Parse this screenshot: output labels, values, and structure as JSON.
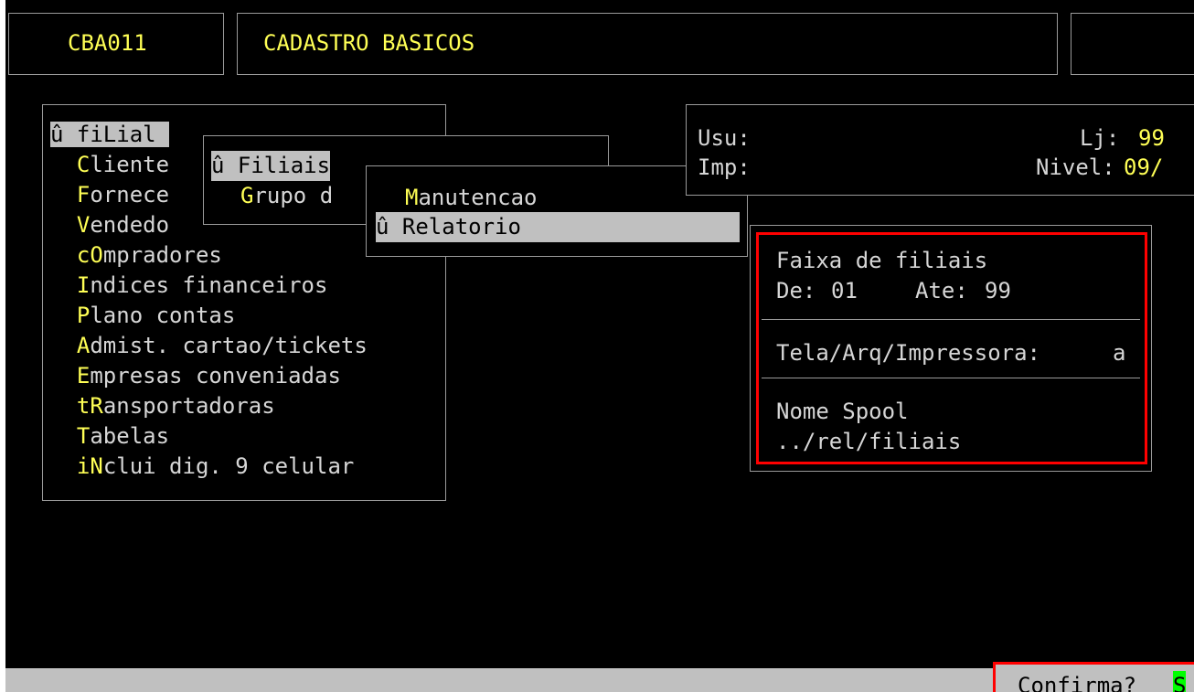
{
  "header": {
    "program_code": "CBA011",
    "title": "CADASTRO BASICOS"
  },
  "main_menu": {
    "items": [
      {
        "prefix": "û ",
        "hotkey": "",
        "rest": "fiLial",
        "selected": true
      },
      {
        "prefix": "  ",
        "hotkey": "C",
        "rest": "liente"
      },
      {
        "prefix": "  ",
        "hotkey": "F",
        "rest": "ornece"
      },
      {
        "prefix": "  ",
        "hotkey": "V",
        "rest": "endedo"
      },
      {
        "prefix": "  ",
        "hotkey": "cO",
        "rest": "mpradores"
      },
      {
        "prefix": "  ",
        "hotkey": "I",
        "rest": "ndices financeiros"
      },
      {
        "prefix": "  ",
        "hotkey": "P",
        "rest": "lano contas"
      },
      {
        "prefix": "  ",
        "hotkey": "A",
        "rest": "dmist. cartao/tickets"
      },
      {
        "prefix": "  ",
        "hotkey": "E",
        "rest": "mpresas conveniadas"
      },
      {
        "prefix": "  ",
        "hotkey": "tR",
        "rest": "ansportadoras"
      },
      {
        "prefix": "  ",
        "hotkey": "T",
        "rest": "abelas"
      },
      {
        "prefix": "  ",
        "hotkey": "iN",
        "rest": "clui dig. 9 celular"
      }
    ]
  },
  "submenu_filial": {
    "items": [
      {
        "label": "û Filiais",
        "selected": true
      },
      {
        "hotkey": "G",
        "rest": "rupo d"
      }
    ]
  },
  "submenu_filiais": {
    "items": [
      {
        "hotkey": "M",
        "rest": "anutencao"
      },
      {
        "label": "û Relatorio",
        "selected": true
      }
    ]
  },
  "status_box": {
    "usu_label": "Usu:",
    "imp_label": "Imp:",
    "lj_label": "Lj:",
    "lj_value": "99",
    "nivel_label": "Nivel:",
    "nivel_value": "09/"
  },
  "report_dialog": {
    "range_title": "Faixa de filiais",
    "de_label": "De:",
    "de_value": "01",
    "ate_label": "Ate:",
    "ate_value": "99",
    "output_label": "Tela/Arq/Impressora:",
    "output_value": "a",
    "spool_label": "Nome Spool",
    "spool_value": "../rel/filiais"
  },
  "bottom_bar": {
    "confirm_label": "Confirma?",
    "confirm_value": "S"
  },
  "colors": {
    "background": "#000000",
    "text": "#d6d6d6",
    "hotkey": "#ffff55",
    "selection_bg": "#c0c0c0",
    "highlight_border": "#ff0000",
    "confirm_value_bg": "#00ff00"
  }
}
